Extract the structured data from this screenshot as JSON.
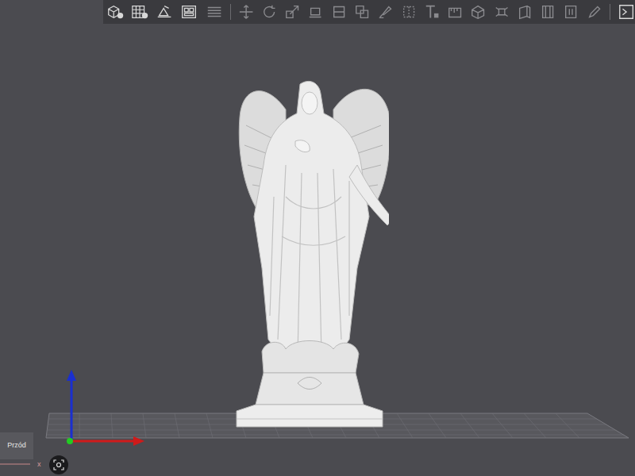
{
  "view_label": "Przód",
  "axis_label": "x"
}
